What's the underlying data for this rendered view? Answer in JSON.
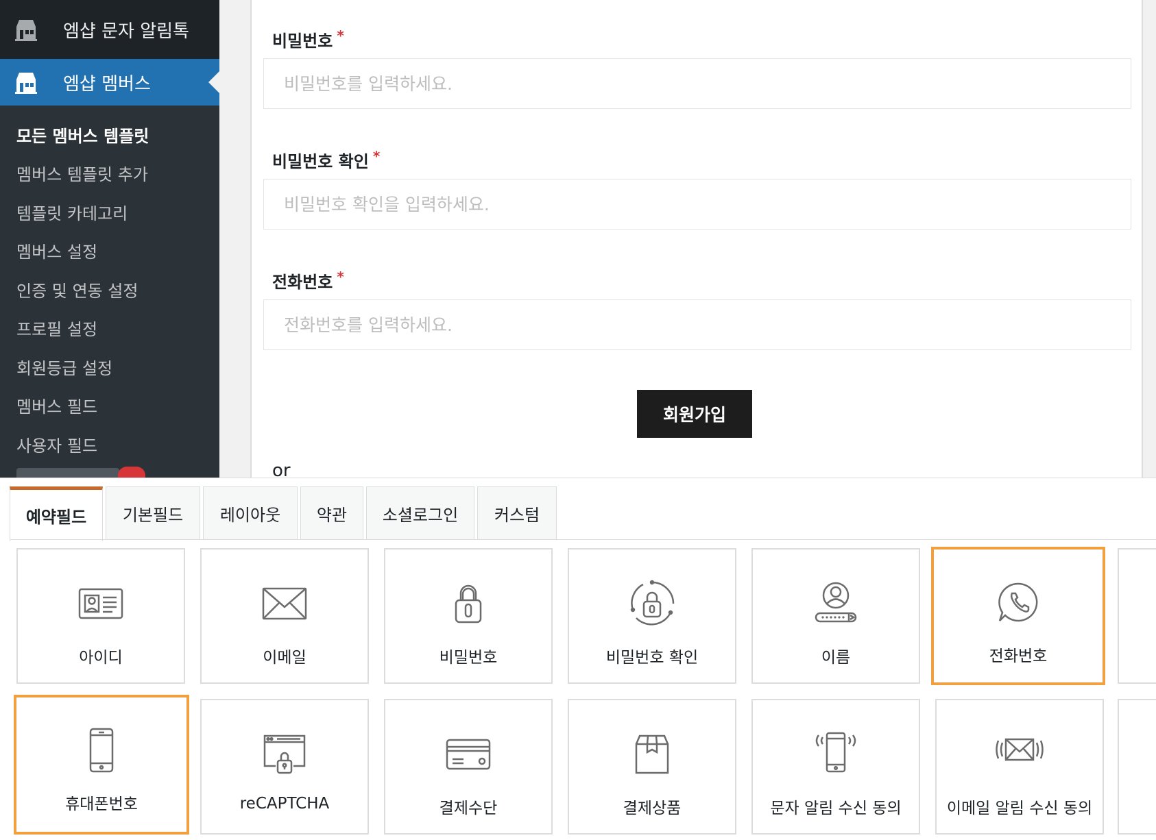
{
  "sidebar": {
    "top_item": "엠샵 문자 알림톡",
    "current_item": "엠샵 멤버스",
    "submenu": [
      "모든 멤버스 템플릿",
      "멤버스 템플릿 추가",
      "템플릿 카테고리",
      "멤버스 설정",
      "인증 및 연동 설정",
      "프로필 설정",
      "회원등급 설정",
      "멤버스 필드",
      "사용자 필드"
    ]
  },
  "form": {
    "fields": [
      {
        "label": "비밀번호",
        "required": "*",
        "placeholder": "비밀번호를 입력하세요."
      },
      {
        "label": "비밀번호 확인",
        "required": "*",
        "placeholder": "비밀번호 확인을 입력하세요."
      },
      {
        "label": "전화번호",
        "required": "*",
        "placeholder": "전화번호를 입력하세요."
      }
    ],
    "submit_label": "회원가입",
    "or_text": "or"
  },
  "panel": {
    "tabs": [
      "예약필드",
      "기본필드",
      "레이아웃",
      "약관",
      "소셜로그인",
      "커스텀"
    ],
    "active_tab": "예약필드",
    "cards_row1": [
      {
        "label": "아이디",
        "icon": "id-card-icon"
      },
      {
        "label": "이메일",
        "icon": "envelope-icon"
      },
      {
        "label": "비밀번호",
        "icon": "lock-icon"
      },
      {
        "label": "비밀번호 확인",
        "icon": "lock-refresh-icon"
      },
      {
        "label": "이름",
        "icon": "user-name-icon"
      },
      {
        "label": "전화번호",
        "icon": "whatsapp-phone-icon"
      }
    ],
    "cards_row2": [
      {
        "label": "휴대폰번호",
        "icon": "mobile-phone-icon"
      },
      {
        "label": "reCAPTCHA",
        "icon": "browser-lock-icon"
      },
      {
        "label": "결제수단",
        "icon": "credit-card-icon"
      },
      {
        "label": "결제상품",
        "icon": "box-icon"
      },
      {
        "label": "문자 알림 수신 동의",
        "icon": "phone-notification-icon"
      },
      {
        "label": "이메일 알림 수신 동의",
        "icon": "email-notification-icon"
      }
    ],
    "highlight_color": "#f0a040",
    "active_tab_color": "#c7692a"
  }
}
